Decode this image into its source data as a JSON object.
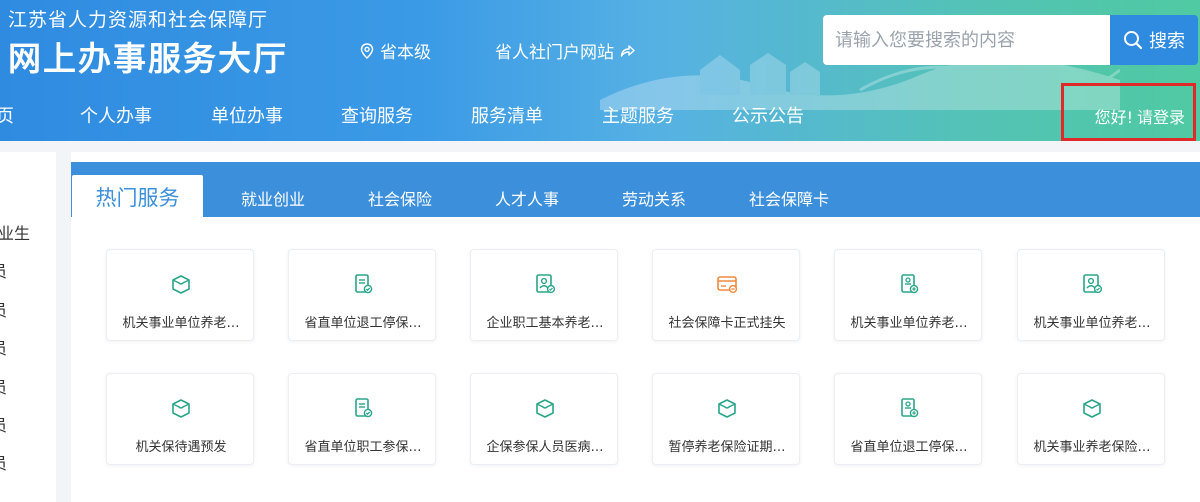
{
  "header": {
    "subtitle": "江苏省人力资源和社会保障厅",
    "title": "网上办事服务大厅",
    "location": "省本级",
    "portal_link": "省人社门户网站",
    "search_placeholder": "请输入您要搜索的内容",
    "search_button": "搜索",
    "greeting": "您好!",
    "login": "请登录"
  },
  "nav": {
    "partial_first": "页",
    "items": [
      "个人办事",
      "单位办事",
      "查询服务",
      "服务清单",
      "主题服务",
      "公示公告"
    ]
  },
  "sidebar": {
    "items": [
      "业生",
      "员",
      "员",
      "员",
      "员",
      "员",
      "员"
    ]
  },
  "tabs": {
    "active": "热门服务",
    "items": [
      "就业创业",
      "社会保险",
      "人才人事",
      "劳动关系",
      "社会保障卡"
    ]
  },
  "services": [
    {
      "label": "机关事业单位养老…",
      "icon": "box-icon"
    },
    {
      "label": "省直单位退工停保…",
      "icon": "document-check-icon"
    },
    {
      "label": "企业职工基本养老…",
      "icon": "id-card-icon"
    },
    {
      "label": "社会保障卡正式挂失",
      "icon": "card-icon"
    },
    {
      "label": "机关事业单位养老…",
      "icon": "document-add-icon"
    },
    {
      "label": "机关事业单位养老…",
      "icon": "id-card-icon"
    },
    {
      "label": "机关保待遇预发",
      "icon": "box-icon"
    },
    {
      "label": "省直单位职工参保…",
      "icon": "document-check-icon"
    },
    {
      "label": "企保参保人员医病…",
      "icon": "box-icon"
    },
    {
      "label": "暂停养老保险证期…",
      "icon": "box-icon"
    },
    {
      "label": "省直单位退工停保…",
      "icon": "document-add-icon"
    },
    {
      "label": "机关事业养老保险…",
      "icon": "box-icon"
    }
  ],
  "colors": {
    "primary": "#3c8fdb",
    "icon_green": "#2aa58a",
    "icon_orange": "#f08a3e",
    "login_border": "#e02a2a"
  }
}
